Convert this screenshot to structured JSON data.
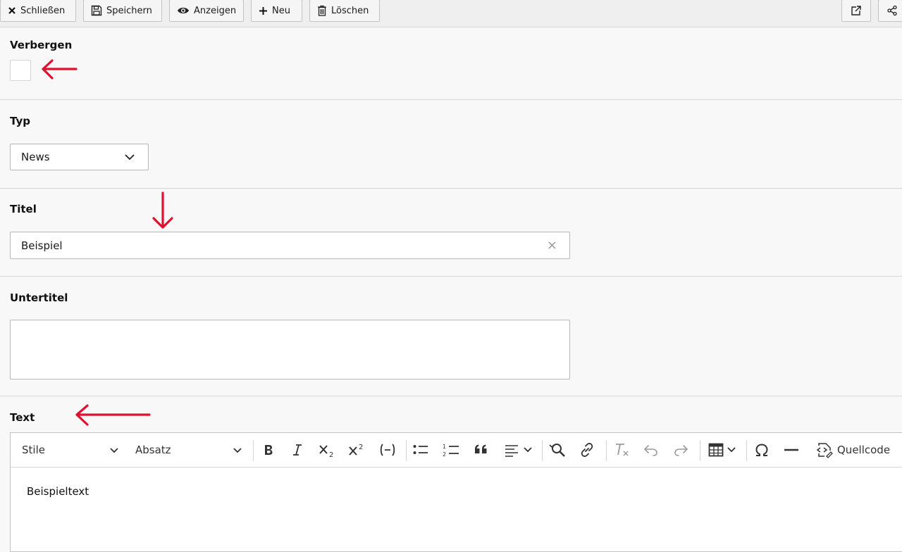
{
  "toolbar": {
    "close_label": "Schließen",
    "save_label": "Speichern",
    "view_label": "Anzeigen",
    "new_label": "Neu",
    "delete_label": "Löschen",
    "open_external_icon": "external-link-icon",
    "share_icon": "share-icon"
  },
  "fields": {
    "hide": {
      "label": "Verbergen",
      "checked": false
    },
    "type": {
      "label": "Typ",
      "value": "News"
    },
    "title": {
      "label": "Titel",
      "value": "Beispiel",
      "clear_symbol": "×"
    },
    "subtitle": {
      "label": "Untertitel",
      "value": ""
    },
    "text": {
      "label": "Text",
      "content": "Beispieltext"
    }
  },
  "editor": {
    "style_select": "Stile",
    "format_select": "Absatz",
    "source_label": "Quellcode",
    "tools": [
      "bold-icon",
      "italic-icon",
      "subscript-icon",
      "superscript-icon",
      "code-icon",
      "bullet-list-icon",
      "numbered-list-icon",
      "blockquote-icon",
      "align-icon",
      "find-replace-icon",
      "link-icon",
      "remove-format-icon",
      "undo-icon",
      "redo-icon",
      "table-icon",
      "special-char-icon",
      "horizontal-line-icon",
      "source-code-icon"
    ]
  },
  "annotations": {
    "arrow_color": "#e0102f"
  }
}
